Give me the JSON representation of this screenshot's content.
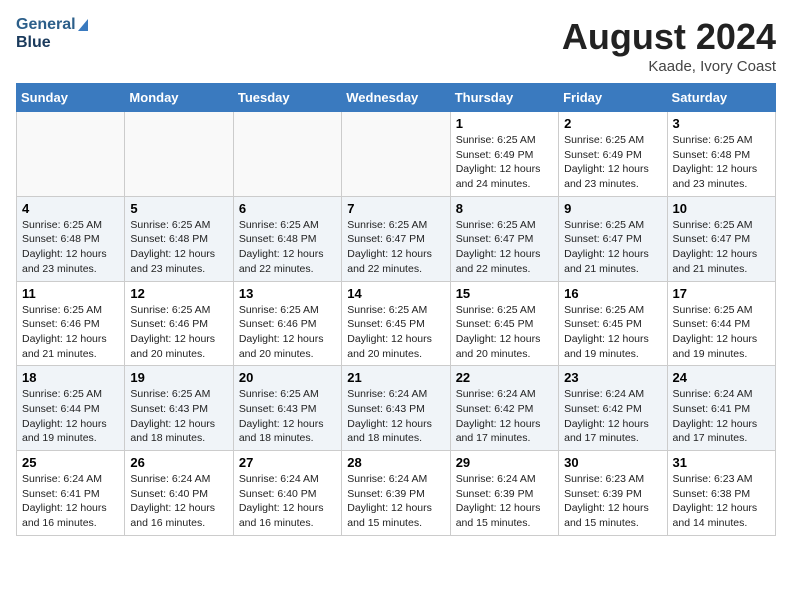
{
  "header": {
    "logo_line1": "General",
    "logo_line2": "Blue",
    "month_year": "August 2024",
    "location": "Kaade, Ivory Coast"
  },
  "days_of_week": [
    "Sunday",
    "Monday",
    "Tuesday",
    "Wednesday",
    "Thursday",
    "Friday",
    "Saturday"
  ],
  "weeks": [
    [
      {
        "day": "",
        "info": ""
      },
      {
        "day": "",
        "info": ""
      },
      {
        "day": "",
        "info": ""
      },
      {
        "day": "",
        "info": ""
      },
      {
        "day": "1",
        "info": "Sunrise: 6:25 AM\nSunset: 6:49 PM\nDaylight: 12 hours\nand 24 minutes."
      },
      {
        "day": "2",
        "info": "Sunrise: 6:25 AM\nSunset: 6:49 PM\nDaylight: 12 hours\nand 23 minutes."
      },
      {
        "day": "3",
        "info": "Sunrise: 6:25 AM\nSunset: 6:48 PM\nDaylight: 12 hours\nand 23 minutes."
      }
    ],
    [
      {
        "day": "4",
        "info": "Sunrise: 6:25 AM\nSunset: 6:48 PM\nDaylight: 12 hours\nand 23 minutes."
      },
      {
        "day": "5",
        "info": "Sunrise: 6:25 AM\nSunset: 6:48 PM\nDaylight: 12 hours\nand 23 minutes."
      },
      {
        "day": "6",
        "info": "Sunrise: 6:25 AM\nSunset: 6:48 PM\nDaylight: 12 hours\nand 22 minutes."
      },
      {
        "day": "7",
        "info": "Sunrise: 6:25 AM\nSunset: 6:47 PM\nDaylight: 12 hours\nand 22 minutes."
      },
      {
        "day": "8",
        "info": "Sunrise: 6:25 AM\nSunset: 6:47 PM\nDaylight: 12 hours\nand 22 minutes."
      },
      {
        "day": "9",
        "info": "Sunrise: 6:25 AM\nSunset: 6:47 PM\nDaylight: 12 hours\nand 21 minutes."
      },
      {
        "day": "10",
        "info": "Sunrise: 6:25 AM\nSunset: 6:47 PM\nDaylight: 12 hours\nand 21 minutes."
      }
    ],
    [
      {
        "day": "11",
        "info": "Sunrise: 6:25 AM\nSunset: 6:46 PM\nDaylight: 12 hours\nand 21 minutes."
      },
      {
        "day": "12",
        "info": "Sunrise: 6:25 AM\nSunset: 6:46 PM\nDaylight: 12 hours\nand 20 minutes."
      },
      {
        "day": "13",
        "info": "Sunrise: 6:25 AM\nSunset: 6:46 PM\nDaylight: 12 hours\nand 20 minutes."
      },
      {
        "day": "14",
        "info": "Sunrise: 6:25 AM\nSunset: 6:45 PM\nDaylight: 12 hours\nand 20 minutes."
      },
      {
        "day": "15",
        "info": "Sunrise: 6:25 AM\nSunset: 6:45 PM\nDaylight: 12 hours\nand 20 minutes."
      },
      {
        "day": "16",
        "info": "Sunrise: 6:25 AM\nSunset: 6:45 PM\nDaylight: 12 hours\nand 19 minutes."
      },
      {
        "day": "17",
        "info": "Sunrise: 6:25 AM\nSunset: 6:44 PM\nDaylight: 12 hours\nand 19 minutes."
      }
    ],
    [
      {
        "day": "18",
        "info": "Sunrise: 6:25 AM\nSunset: 6:44 PM\nDaylight: 12 hours\nand 19 minutes."
      },
      {
        "day": "19",
        "info": "Sunrise: 6:25 AM\nSunset: 6:43 PM\nDaylight: 12 hours\nand 18 minutes."
      },
      {
        "day": "20",
        "info": "Sunrise: 6:25 AM\nSunset: 6:43 PM\nDaylight: 12 hours\nand 18 minutes."
      },
      {
        "day": "21",
        "info": "Sunrise: 6:24 AM\nSunset: 6:43 PM\nDaylight: 12 hours\nand 18 minutes."
      },
      {
        "day": "22",
        "info": "Sunrise: 6:24 AM\nSunset: 6:42 PM\nDaylight: 12 hours\nand 17 minutes."
      },
      {
        "day": "23",
        "info": "Sunrise: 6:24 AM\nSunset: 6:42 PM\nDaylight: 12 hours\nand 17 minutes."
      },
      {
        "day": "24",
        "info": "Sunrise: 6:24 AM\nSunset: 6:41 PM\nDaylight: 12 hours\nand 17 minutes."
      }
    ],
    [
      {
        "day": "25",
        "info": "Sunrise: 6:24 AM\nSunset: 6:41 PM\nDaylight: 12 hours\nand 16 minutes."
      },
      {
        "day": "26",
        "info": "Sunrise: 6:24 AM\nSunset: 6:40 PM\nDaylight: 12 hours\nand 16 minutes."
      },
      {
        "day": "27",
        "info": "Sunrise: 6:24 AM\nSunset: 6:40 PM\nDaylight: 12 hours\nand 16 minutes."
      },
      {
        "day": "28",
        "info": "Sunrise: 6:24 AM\nSunset: 6:39 PM\nDaylight: 12 hours\nand 15 minutes."
      },
      {
        "day": "29",
        "info": "Sunrise: 6:24 AM\nSunset: 6:39 PM\nDaylight: 12 hours\nand 15 minutes."
      },
      {
        "day": "30",
        "info": "Sunrise: 6:23 AM\nSunset: 6:39 PM\nDaylight: 12 hours\nand 15 minutes."
      },
      {
        "day": "31",
        "info": "Sunrise: 6:23 AM\nSunset: 6:38 PM\nDaylight: 12 hours\nand 14 minutes."
      }
    ]
  ]
}
